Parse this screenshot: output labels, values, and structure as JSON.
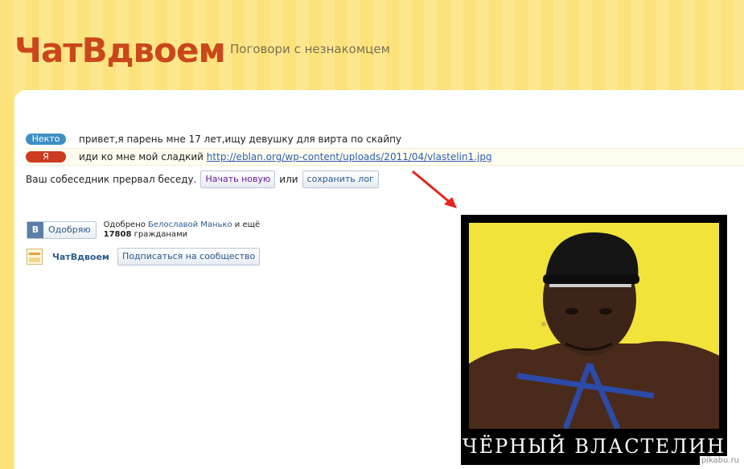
{
  "header": {
    "logo": "ЧатВдвоем",
    "tagline": "Поговори с незнакомцем"
  },
  "messages": [
    {
      "sender": "Некто",
      "text": "привет,я парень мне 17 лет,ищу девушку для вирта по скайпу",
      "link": ""
    },
    {
      "sender": "Я",
      "text": "иди ко мне мой сладкий ",
      "link": "http://eblan.org/wp-content/uploads/2011/04/vlastelin1.jpg"
    }
  ],
  "status": {
    "text": "Ваш собеседник прервал беседу.",
    "new_chat_button": "Начать новую",
    "or": "или",
    "save_log_button": "сохранить лог"
  },
  "vk_like": {
    "logo": "В",
    "button_label": "Одобряю",
    "approved_prefix": "Одобрено ",
    "approved_by": "Белославой Манько",
    "approved_suffix": " и ещё",
    "count": "17808",
    "count_suffix": " гражданами"
  },
  "vk_group": {
    "name": "ЧатВдвоем",
    "subscribe_button": "Подписаться на сообщество"
  },
  "poster": {
    "caption": "ЧЁРНЫЙ ВЛАСТЕЛИН"
  },
  "watermark": "pikabu.ru",
  "colors": {
    "logo": "#c9471b",
    "stranger_badge": "#3f8fc6",
    "me_badge": "#cc3a1f",
    "arrow": "#e8231b",
    "poster_background": "#f2e33a"
  }
}
